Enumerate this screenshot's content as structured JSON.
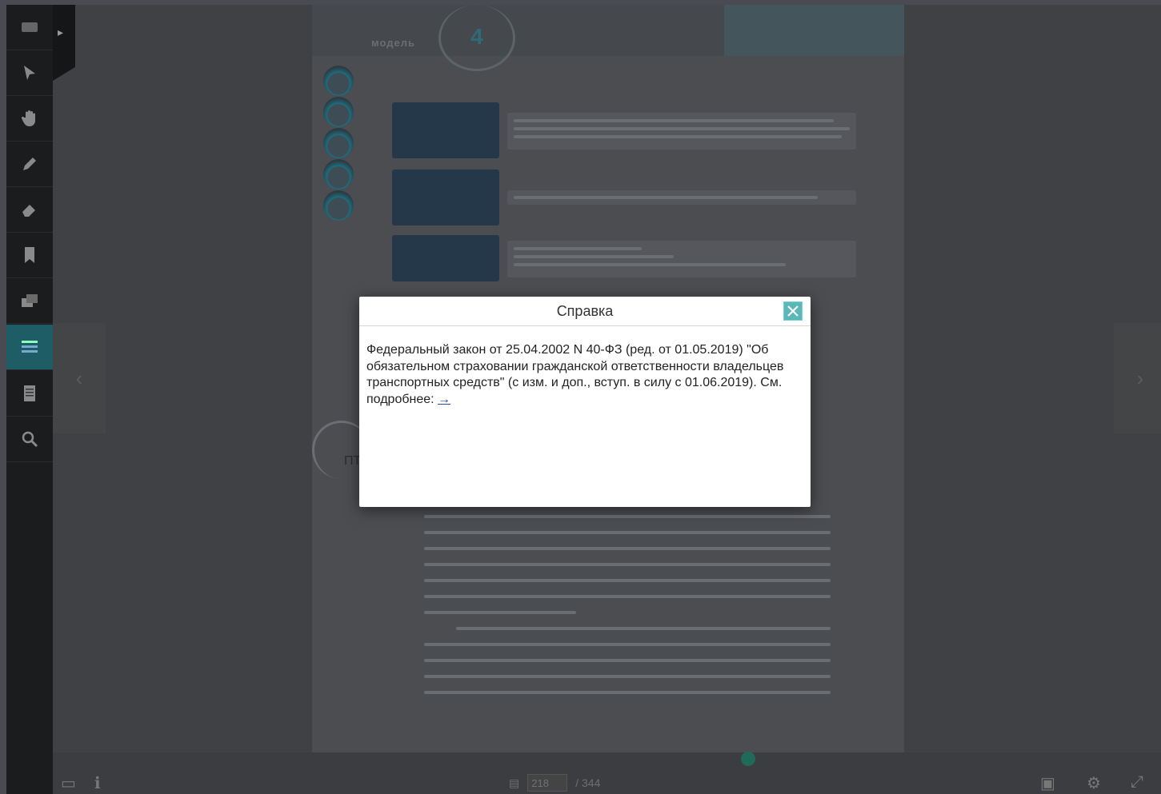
{
  "toolbar": {
    "expand_label": "▸",
    "tools": [
      {
        "name": "thumbnails-icon"
      },
      {
        "name": "cursor-icon"
      },
      {
        "name": "hand-icon"
      },
      {
        "name": "pencil-icon"
      },
      {
        "name": "eraser-icon"
      },
      {
        "name": "bookmark-icon"
      },
      {
        "name": "notes-icon"
      },
      {
        "name": "references-icon",
        "active": true
      },
      {
        "name": "contents-icon"
      },
      {
        "name": "search-icon"
      }
    ]
  },
  "page": {
    "chapter_label": "модель",
    "chapter_number": "4",
    "side_label": "ПТ"
  },
  "modal": {
    "title": "Справка",
    "body_text": "Федеральный закон от 25.04.2002 N 40-ФЗ (ред. от 01.05.2019) \"Об обязательном страховании гражданской ответственности владельцев транспортных средств\" (с изм. и доп., вступ. в силу с 01.06.2019). См. подробнее: ",
    "link_text": "→"
  },
  "bottombar": {
    "current_page": "218",
    "total_pages": "/ 344"
  },
  "colors": {
    "accent": "#1f5d66",
    "close_button": "#5bb8b8",
    "link": "#2d4aa8"
  }
}
